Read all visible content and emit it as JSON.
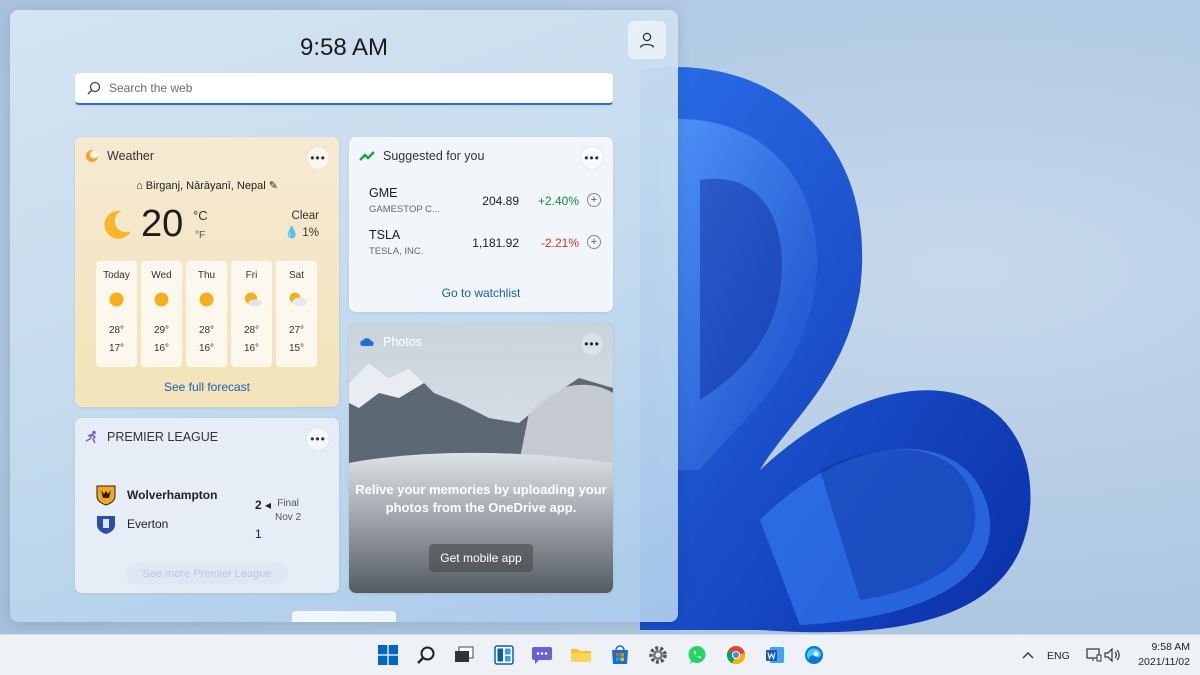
{
  "panel": {
    "clock": "9:58 AM",
    "search_placeholder": "Search the web"
  },
  "weather": {
    "title": "Weather",
    "location": "Birganj, Nārāyanī, Nepal",
    "temp": "20",
    "unit_c": "°C",
    "unit_f": "°F",
    "condition": "Clear",
    "precip": "1%",
    "forecast": [
      {
        "day": "Today",
        "high": "28°",
        "low": "17°",
        "icon": "sunny-icon"
      },
      {
        "day": "Wed",
        "high": "29°",
        "low": "16°",
        "icon": "sunny-icon"
      },
      {
        "day": "Thu",
        "high": "28°",
        "low": "16°",
        "icon": "sunny-icon"
      },
      {
        "day": "Fri",
        "high": "28°",
        "low": "16°",
        "icon": "partly-sunny-icon"
      },
      {
        "day": "Sat",
        "high": "27°",
        "low": "15°",
        "icon": "partly-cloudy-icon"
      }
    ],
    "link": "See full forecast"
  },
  "stocks": {
    "title": "Suggested for you",
    "rows": [
      {
        "symbol": "GME",
        "name": "GAMESTOP C...",
        "price": "204.89",
        "change": "+2.40%",
        "color": "#16893a"
      },
      {
        "symbol": "TSLA",
        "name": "TESLA, INC.",
        "price": "1,181.92",
        "change": "-2.21%",
        "color": "#d0342c"
      }
    ],
    "link": "Go to watchlist"
  },
  "photos": {
    "title": "Photos",
    "message": "Relive your memories by uploading your photos from the OneDrive app.",
    "button": "Get mobile app"
  },
  "league": {
    "title": "PREMIER LEAGUE",
    "home_team": "Wolverhampton",
    "home_score": "2",
    "away_team": "Everton",
    "away_score": "1",
    "status": "Final",
    "date": "Nov 2",
    "link": "See more Premier League"
  },
  "taskbar": {
    "lang": "ENG",
    "time": "9:58 AM",
    "date": "2021/11/02",
    "accent": "#0067c0"
  }
}
